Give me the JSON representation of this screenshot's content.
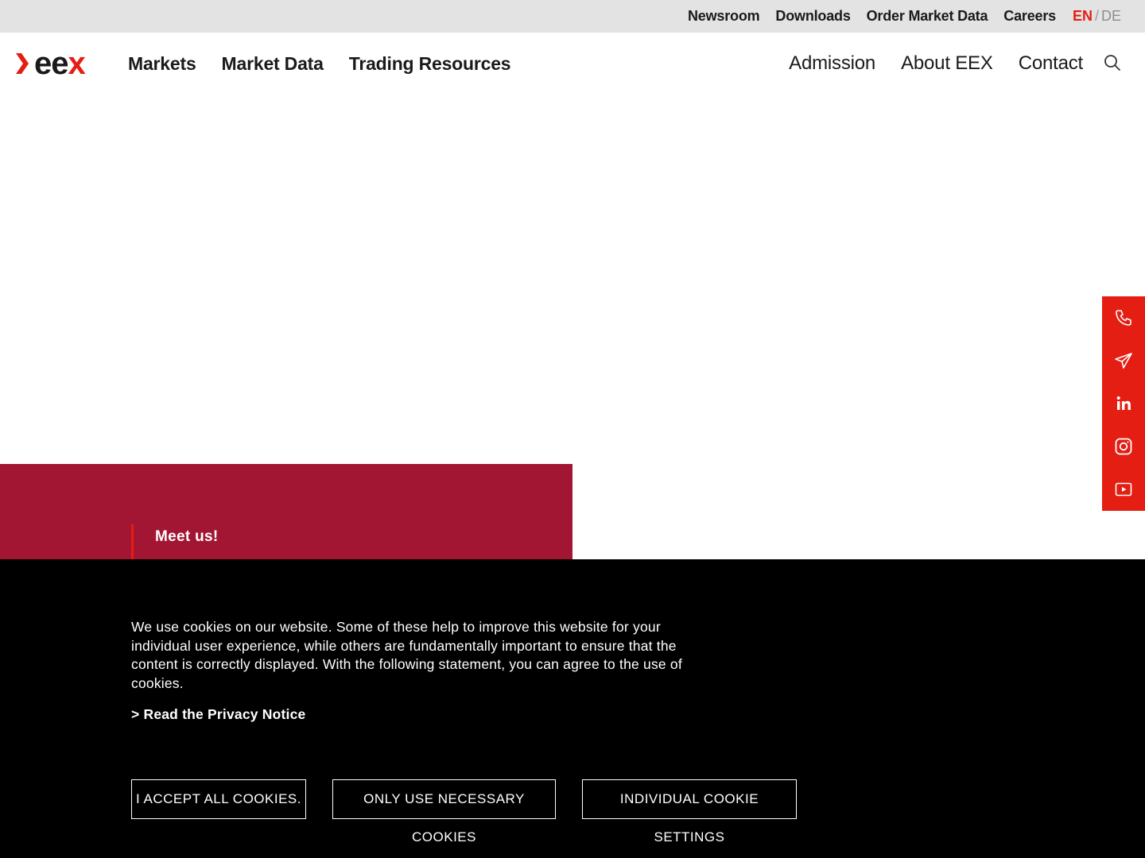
{
  "topbar": {
    "links": [
      "Newsroom",
      "Downloads",
      "Order Market Data",
      "Careers"
    ],
    "lang_active": "EN",
    "lang_sep": "/",
    "lang_other": "DE"
  },
  "logo": {
    "text_ee": "ee",
    "text_x": "x"
  },
  "nav": {
    "main": [
      "Markets",
      "Market Data",
      "Trading Resources"
    ],
    "secondary": [
      "Admission",
      "About EEX",
      "Contact"
    ]
  },
  "social": [
    "phone-icon",
    "send-icon",
    "linkedin-icon",
    "instagram-icon",
    "youtube-icon"
  ],
  "promo": {
    "label": "Meet us!"
  },
  "cookie": {
    "message": "We use cookies on our website. Some of these help to improve this website for your individual user experience, while others are fundamentally important to ensure that the content is correctly displayed. With the following statement, you can agree to the use of cookies.",
    "privacy_link": "> Read the Privacy Notice",
    "accept_all": "I ACCEPT ALL COOKIES.",
    "necessary_only": "ONLY USE NECESSARY COOKIES",
    "individual": "INDIVIDUAL COOKIE SETTINGS"
  },
  "colors": {
    "accent": "#e41e13",
    "promo_bg": "#a21633",
    "topbar_bg": "#e3e3e3",
    "cookie_bg": "#000000"
  }
}
